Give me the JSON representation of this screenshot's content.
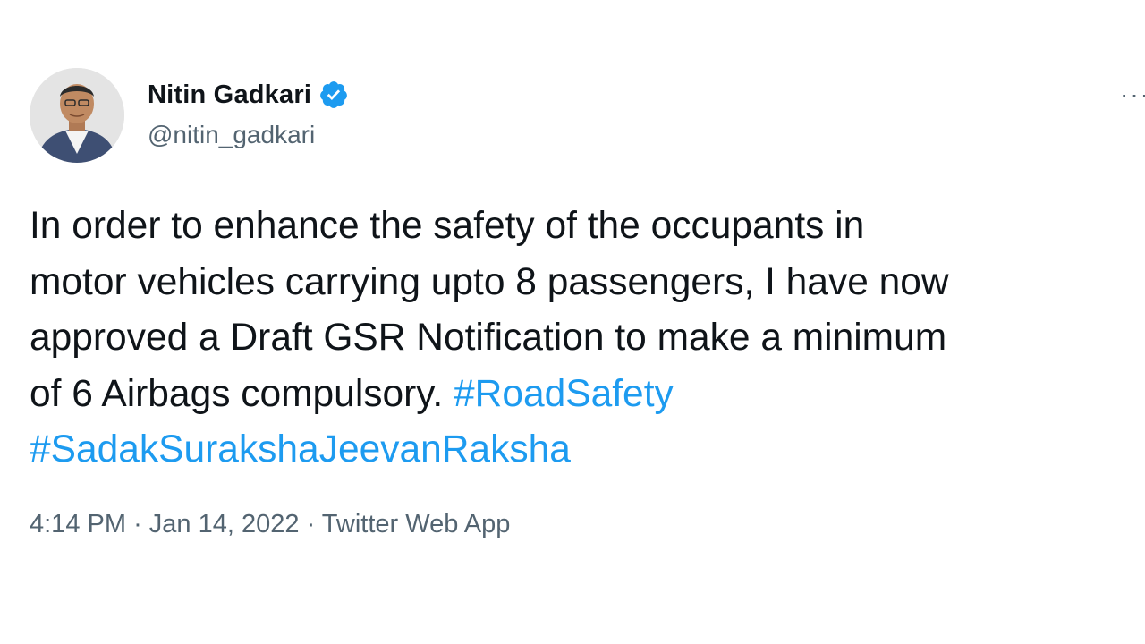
{
  "author": {
    "name": "Nitin Gadkari",
    "handle": "@nitin_gadkari",
    "verified_color": "#1d9bf0"
  },
  "more_label": "···",
  "tweet": {
    "line1": "In order to enhance the safety of the occupants in",
    "line2": "motor vehicles carrying upto 8 passengers, I have now",
    "line3": "approved a Draft GSR Notification to make a minimum",
    "line4_text": "of 6 Airbags compulsory.",
    "hashtag1": "#RoadSafety",
    "hashtag2": "#SadakSurakshaJeevanRaksha",
    "hashtag_color": "#1d9bf0"
  },
  "meta": {
    "time": "4:14 PM",
    "date": "Jan 14, 2022",
    "source": "Twitter Web App",
    "separator": "·"
  }
}
